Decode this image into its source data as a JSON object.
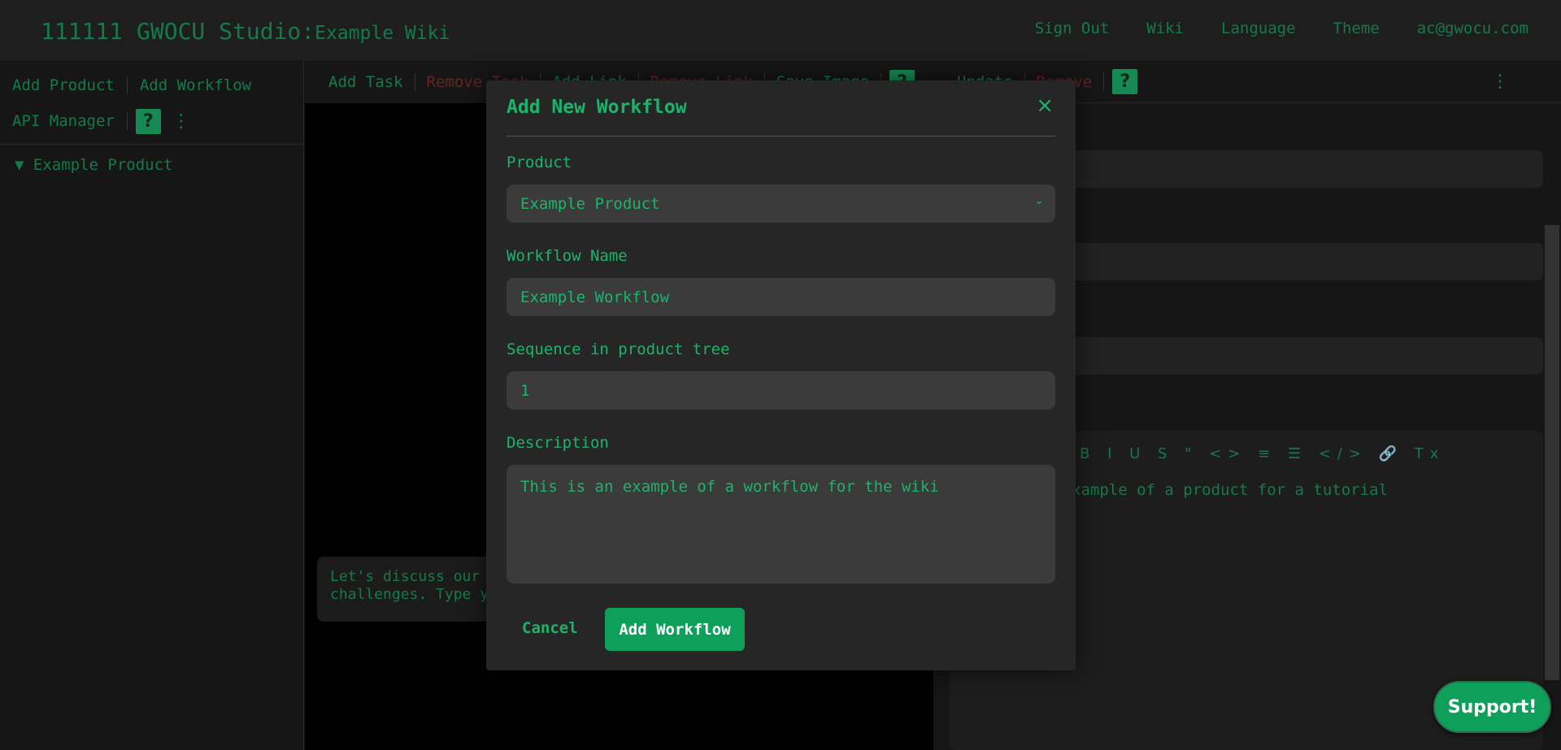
{
  "header": {
    "brand": "111111 GWOCU Studio:",
    "wiki_name": "Example Wiki",
    "nav": [
      "Sign Out",
      "Wiki",
      "Language",
      "Theme",
      "ac@gwocu.com"
    ]
  },
  "sidebar": {
    "add_product": "Add Product",
    "add_workflow": "Add Workflow",
    "api_manager": "API Manager",
    "help": "?",
    "more": "⋮",
    "tree_item": "▼ Example Product"
  },
  "center": {
    "toolbar": [
      "Add Task",
      "Remove Task",
      "Add Link",
      "Remove Link",
      "Save Image"
    ],
    "help": "?",
    "chat_text": "Let's discuss our\nchallenges. Type y"
  },
  "right": {
    "toolbar": [
      "Update",
      "Remove"
    ],
    "help": "?",
    "more": "⋮",
    "editor_tools": "B I U S \" <> ≡ ☰ </> 🔗 Tx",
    "editor_content": "xample of a product for a tutorial"
  },
  "modal": {
    "title": "Add New Workflow",
    "close": "×",
    "product_label": "Product",
    "product_value": "Example Product",
    "name_label": "Workflow Name",
    "name_value": "Example Workflow",
    "sequence_label": "Sequence in product tree",
    "sequence_value": "1",
    "description_label": "Description",
    "description_value": "This is an example of a workflow for the wiki",
    "cancel": "Cancel",
    "submit": "Add Workflow"
  },
  "support": "Support!",
  "colors": {
    "accent": "#1db36b",
    "dim_accent": "#157a4a",
    "button": "#0ea05a",
    "danger": "#6b2222"
  }
}
